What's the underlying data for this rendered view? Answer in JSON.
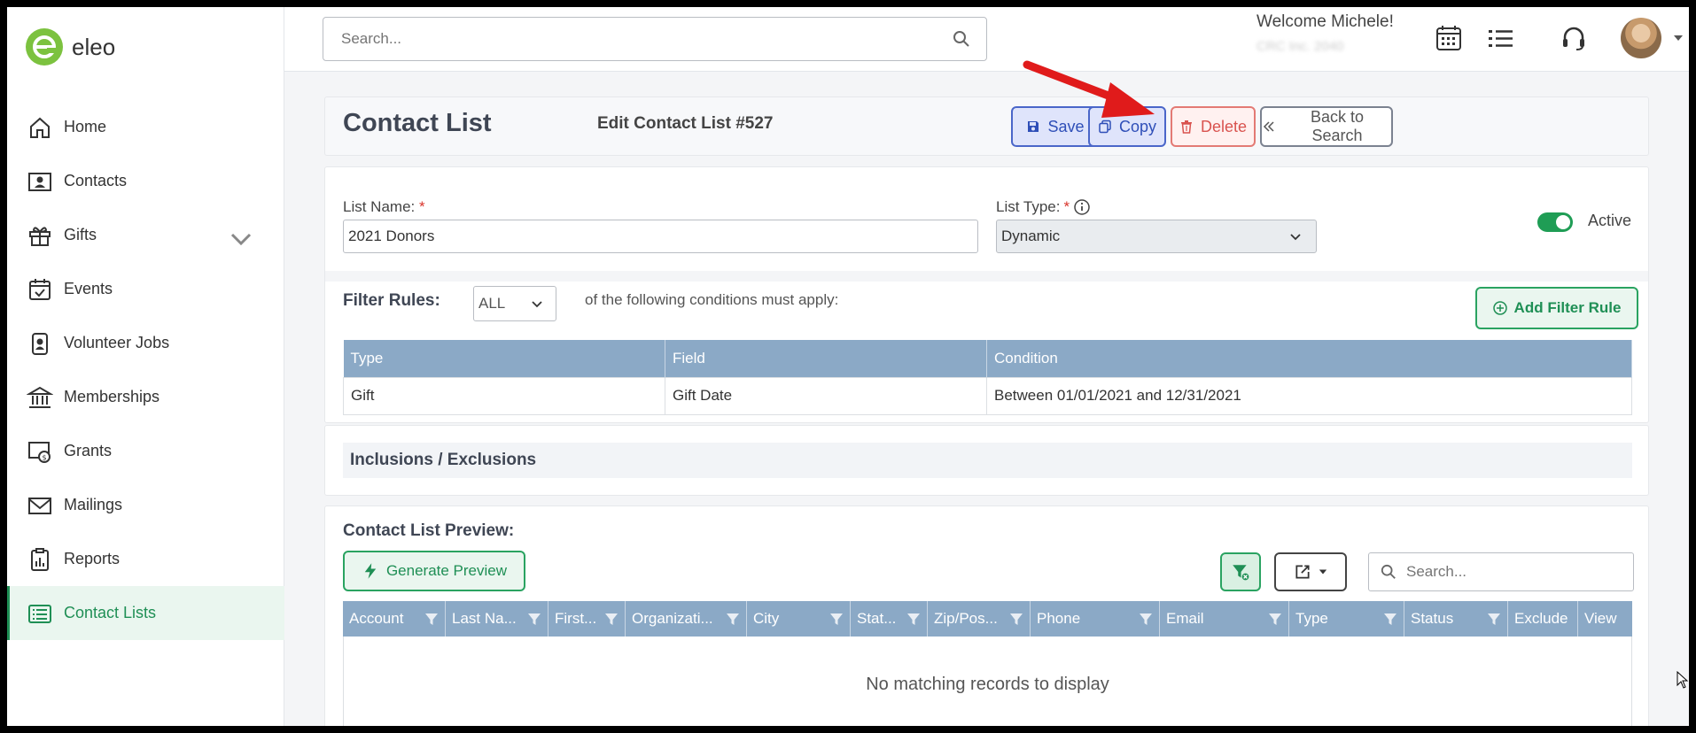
{
  "app": {
    "logo_text": "eleo"
  },
  "sidebar": {
    "items": [
      {
        "label": "Home",
        "icon": "home-icon"
      },
      {
        "label": "Contacts",
        "icon": "contact-card-icon"
      },
      {
        "label": "Gifts",
        "icon": "gift-icon",
        "expandable": true
      },
      {
        "label": "Events",
        "icon": "calendar-check-icon"
      },
      {
        "label": "Volunteer Jobs",
        "icon": "badge-icon"
      },
      {
        "label": "Memberships",
        "icon": "building-icon"
      },
      {
        "label": "Grants",
        "icon": "grant-icon"
      },
      {
        "label": "Mailings",
        "icon": "envelope-icon"
      },
      {
        "label": "Reports",
        "icon": "report-icon"
      },
      {
        "label": "Contact Lists",
        "icon": "list-icon",
        "active": true
      }
    ]
  },
  "topbar": {
    "search_placeholder": "Search...",
    "welcome": "Welcome Michele!",
    "org_name": "CRC Inc. 2040"
  },
  "header": {
    "title": "Contact List",
    "subtitle": "Edit Contact List #527",
    "save_label": "Save",
    "copy_label": "Copy",
    "delete_label": "Delete",
    "back_label": "Back to Search"
  },
  "form": {
    "list_name_label": "List Name:",
    "list_name_value": "2021 Donors",
    "list_type_label": "List Type:",
    "list_type_value": "Dynamic",
    "active_label": "Active",
    "required_mark": "*"
  },
  "filter": {
    "label": "Filter Rules:",
    "match_value": "ALL",
    "conditions_text": "of the following conditions must apply:",
    "add_rule_label": "Add Filter Rule",
    "columns": [
      "Type",
      "Field",
      "Condition"
    ],
    "rows": [
      {
        "type": "Gift",
        "field": "Gift Date",
        "condition": "Between 01/01/2021 and 12/31/2021"
      }
    ]
  },
  "inclusions": {
    "label": "Inclusions / Exclusions"
  },
  "preview": {
    "title": "Contact List Preview:",
    "generate_label": "Generate Preview",
    "search_placeholder": "Search...",
    "columns": [
      "Account",
      "Last Na...",
      "First...",
      "Organizati...",
      "City",
      "Stat...",
      "Zip/Pos...",
      "Phone",
      "Email",
      "Type",
      "Status",
      "Exclude",
      "View"
    ],
    "empty_text": "No matching records to display"
  },
  "colors": {
    "brand_green": "#7cc23f",
    "accent_green": "#1f8f55",
    "primary_blue": "#4a66c9",
    "danger_red": "#d9534f",
    "table_header": "#8ba9c6"
  }
}
